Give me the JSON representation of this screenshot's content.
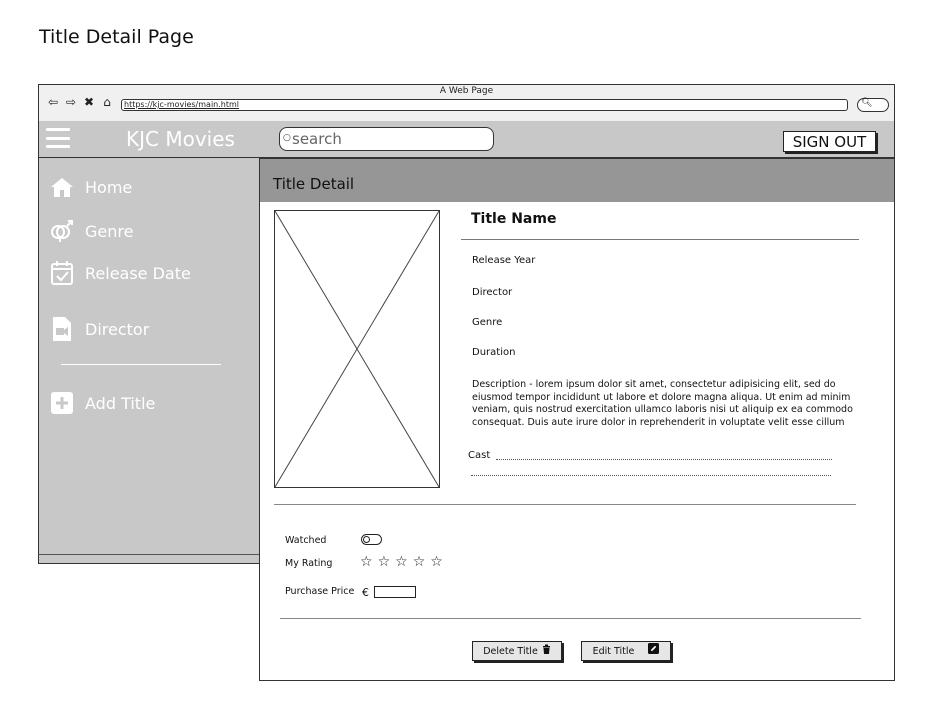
{
  "page": {
    "heading": "Title Detail Page"
  },
  "browser": {
    "window_title": "A Web Page",
    "url": "https://kjc-movies/main.html",
    "nav_icons": [
      "back-arrow-icon",
      "forward-arrow-icon",
      "close-x-icon",
      "home-icon"
    ]
  },
  "appbar": {
    "brand": "KJC Movies",
    "search_placeholder": "search",
    "signout_label": "SIGN OUT"
  },
  "sidebar": {
    "items": [
      {
        "label": "Home",
        "icon": "home-icon"
      },
      {
        "label": "Genre",
        "icon": "gender-icon"
      },
      {
        "label": "Release Date",
        "icon": "calendar-check-icon"
      },
      {
        "label": "Director",
        "icon": "video-file-icon"
      },
      {
        "label": "Add Title",
        "icon": "plus-square-icon"
      }
    ]
  },
  "content": {
    "header": "Title Detail",
    "title_name": "Title Name",
    "release_year": "Release Year",
    "director": "Director",
    "genre": "Genre",
    "duration": "Duration",
    "description": "Description - lorem ipsum dolor sit amet, consectetur adipisicing elit, sed do eiusmod tempor incididunt ut labore et dolore magna aliqua. Ut enim ad minim veniam, quis nostrud exercitation ullamco laboris nisi ut aliquip ex ea commodo consequat. Duis aute irure dolor in reprehenderit in voluptate velit esse cillum",
    "cast_label": "Cast"
  },
  "options": {
    "watched_label": "Watched",
    "watched": false,
    "rating_label": "My Rating",
    "rating": 0,
    "rating_max": 5,
    "purchase_label": "Purchase Price",
    "currency_symbol": "€",
    "purchase_value": ""
  },
  "actions": {
    "delete_label": "Delete Title",
    "delete_icon": "trash-icon",
    "edit_label": "Edit Title",
    "edit_icon": "pencil-icon"
  },
  "colors": {
    "appbar": "#c8c8c8",
    "sidebar": "#c8c8c8",
    "content_header": "#969696",
    "brand_text": "#ffffff"
  }
}
